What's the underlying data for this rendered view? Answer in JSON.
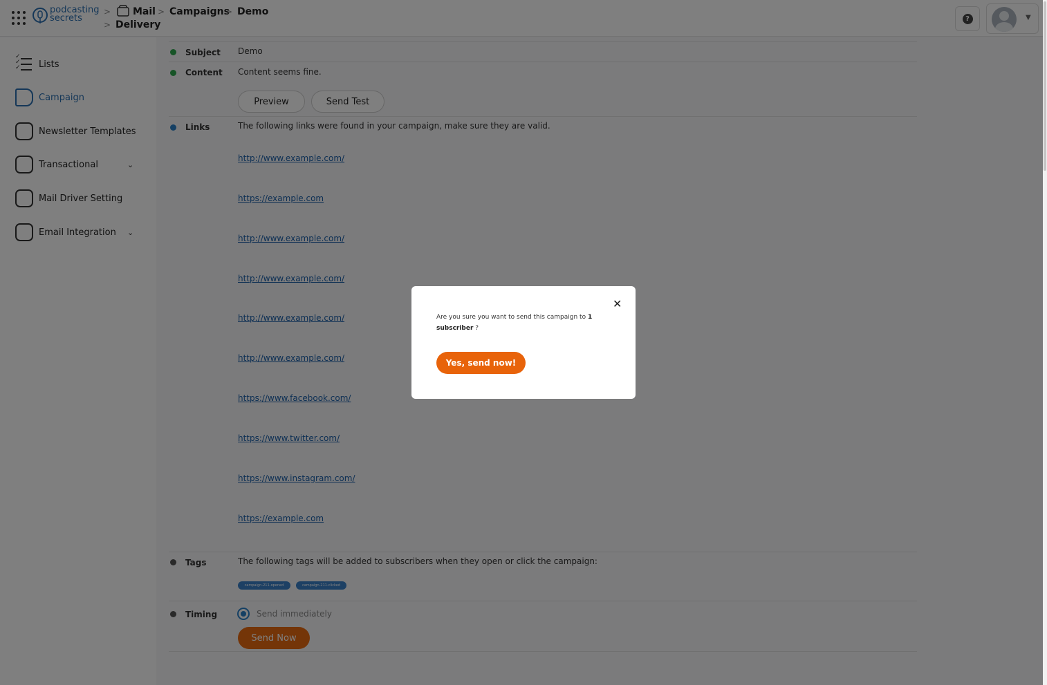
{
  "header": {
    "logo_line1": "podcasting",
    "logo_line2": "secrets",
    "breadcrumb": [
      "Mail",
      "Delivery",
      "Campaigns",
      "Demo"
    ],
    "help_symbol": "?"
  },
  "sidebar": {
    "items": [
      {
        "label": "Lists",
        "icon": "list-check-icon"
      },
      {
        "label": "Campaign",
        "icon": "megaphone-icon",
        "active": true
      },
      {
        "label": "Newsletter Templates",
        "icon": "template-icon"
      },
      {
        "label": "Transactional",
        "icon": "transactional-icon"
      },
      {
        "label": "Mail Driver Setting",
        "icon": "mail-driver-icon"
      },
      {
        "label": "Email Integration",
        "icon": "integration-icon"
      }
    ]
  },
  "review": {
    "subject_label": "Subject",
    "subject_value": "Demo",
    "content_label": "Content",
    "content_value": "Content seems fine.",
    "preview_label": "Preview",
    "send_test_label": "Send Test",
    "links_label": "Links",
    "links_intro": "The following links were found in your campaign, make sure they are valid.",
    "links": [
      "http://www.example.com/",
      "https://example.com",
      "http://www.example.com/",
      "http://www.example.com/",
      "http://www.example.com/",
      "http://www.example.com/",
      "https://www.facebook.com/",
      "https://www.twitter.com/",
      "https://www.instagram.com/",
      "https://example.com"
    ],
    "tags_label": "Tags",
    "tags_intro": "The following tags will be added to subscribers when they open or click the campaign:",
    "tags": [
      "campaign-211-opened",
      "campaign-211-clicked"
    ],
    "timing_label": "Timing",
    "timing_option": "Send immediately",
    "send_now_label": "Send Now"
  },
  "modal": {
    "message_prefix": "Are you sure you want to send this campaign to",
    "message_bold": "1 subscriber",
    "message_suffix": "?",
    "confirm_label": "Yes, send now!",
    "close_symbol": "✕"
  },
  "colors": {
    "accent_blue": "#2a6fb0",
    "send_orange": "#e8630a",
    "status_green": "#2fa84f"
  }
}
